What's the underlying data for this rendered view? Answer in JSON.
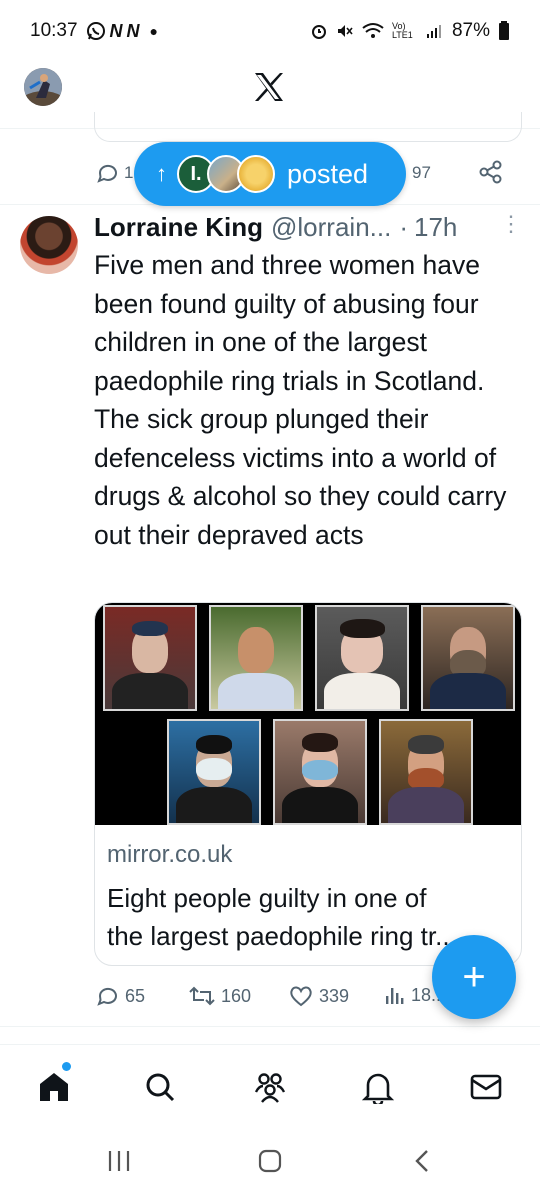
{
  "status_bar": {
    "time": "10:37",
    "notif_icons": [
      "whatsapp-icon",
      "n-app-icon",
      "n-app-icon",
      "dot-icon"
    ],
    "battery": "87%",
    "network_label": "Vo) LTE1"
  },
  "header": {
    "logo": "X"
  },
  "previous_tweet": {
    "comments": "1",
    "views": "97"
  },
  "posted_pill": {
    "label": "posted",
    "avatar_letter": "I."
  },
  "tweet": {
    "name": "Lorraine King",
    "handle": "@lorrain...",
    "separator": "·",
    "time": "17h",
    "text_lines": [
      "Five men and three women have been found guilty of abusing four children in one of the largest paedophile ring trials in Scotland.",
      "The sick group plunged their defenceless victims into a world of drugs & alcohol so they could carry out their depraved acts"
    ],
    "card": {
      "domain": "mirror.co.uk",
      "title_line1": "Eight people guilty in one of",
      "title_line2": "the largest paedophile ring tr..."
    },
    "actions": {
      "replies": "65",
      "reposts": "160",
      "likes": "339",
      "views": "18..."
    }
  },
  "fab": {
    "label": "+"
  },
  "colors": {
    "accent": "#1d9bf0",
    "text": "#0f1419",
    "muted": "#536471"
  }
}
